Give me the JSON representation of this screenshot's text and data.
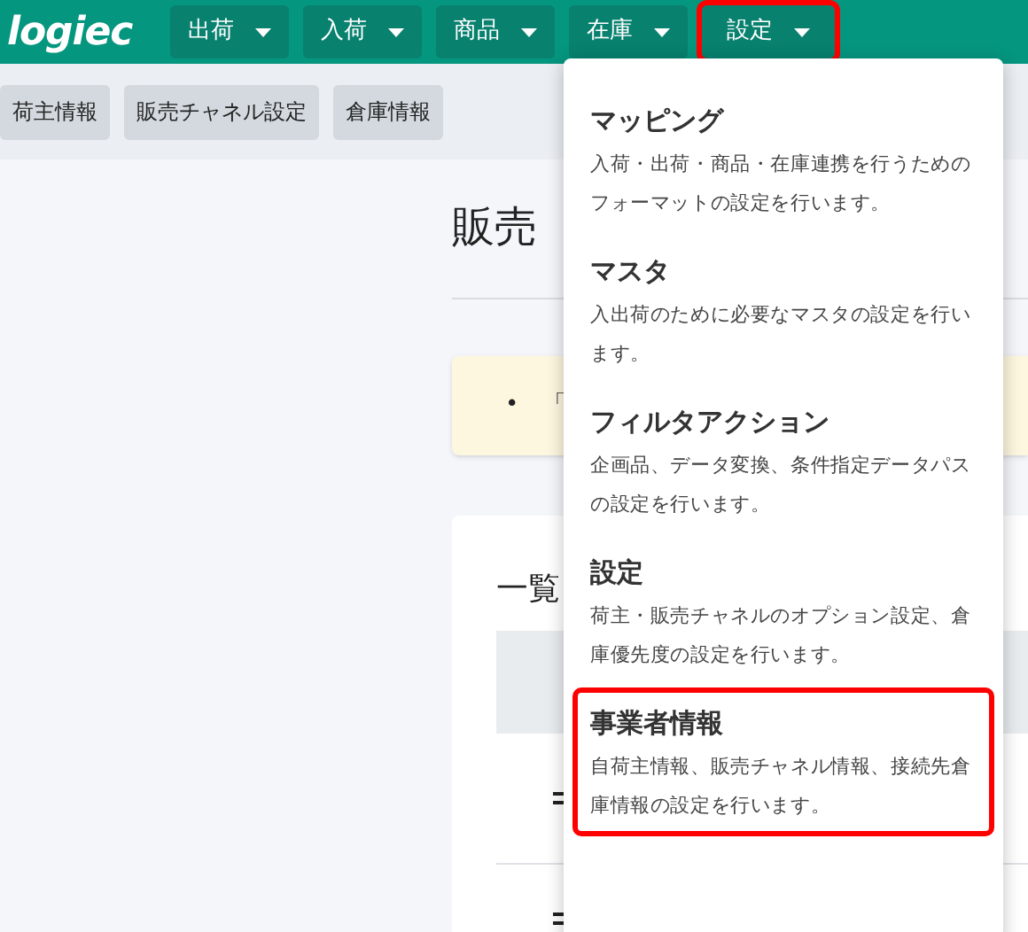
{
  "logo": "logiec",
  "nav": [
    {
      "label": "出荷",
      "selected": false
    },
    {
      "label": "入荷",
      "selected": false
    },
    {
      "label": "商品",
      "selected": false
    },
    {
      "label": "在庫",
      "selected": false
    },
    {
      "label": "設定",
      "selected": true
    }
  ],
  "subnav": [
    "荷主情報",
    "販売チャネル設定",
    "倉庫情報"
  ],
  "page_title": "販売",
  "notice": {
    "bullet": "•",
    "left": "「"
  },
  "list_card": {
    "title": "一覧"
  },
  "menu": [
    {
      "title": "マッピング",
      "description": "入荷・出荷・商品・在庫連携を行うためのフォーマットの設定を行います。",
      "selected": false
    },
    {
      "title": "マスタ",
      "description": "入出荷のために必要なマスタの設定を行います。",
      "selected": false
    },
    {
      "title": "フィルタアクション",
      "description": "企画品、データ変換、条件指定データパスの設定を行います。",
      "selected": false
    },
    {
      "title": "設定",
      "description": "荷主・販売チャネルのオプション設定、倉庫優先度の設定を行います。",
      "selected": false
    },
    {
      "title": "事業者情報",
      "description": "自荷主情報、販売チャネル情報、接続先倉庫情報の設定を行います。",
      "selected": true
    }
  ]
}
